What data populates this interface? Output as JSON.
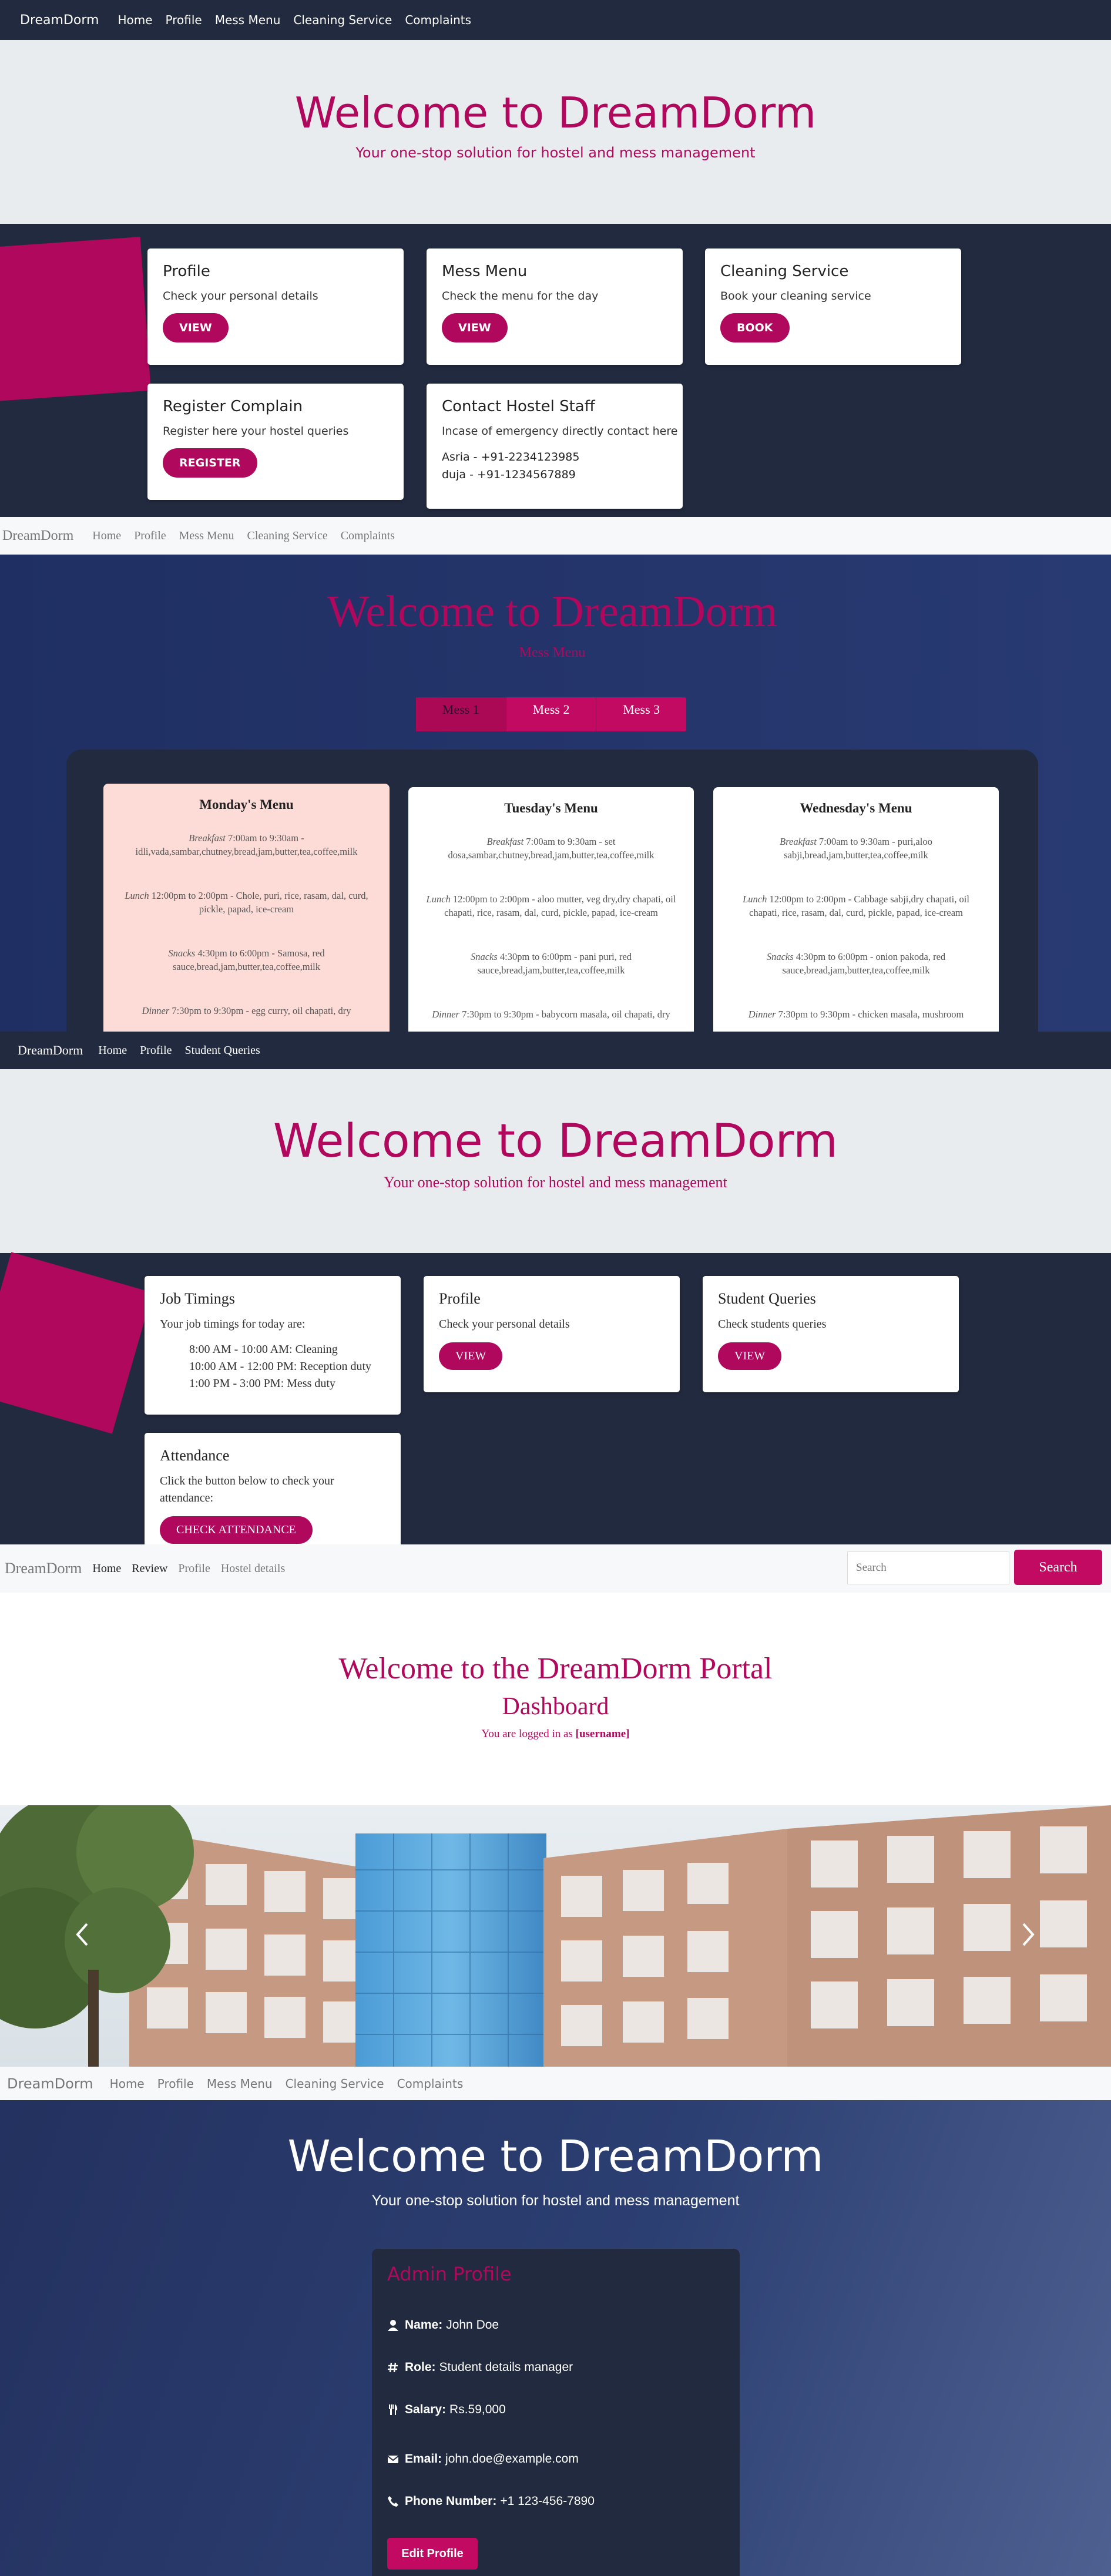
{
  "colors": {
    "accent": "#b0085c",
    "dark_navy": "#222a3f",
    "light_gray": "#e9ecef"
  },
  "s1": {
    "brand": "DreamDorm",
    "nav": [
      "Home",
      "Profile",
      "Mess Menu",
      "Cleaning Service",
      "Complaints"
    ],
    "title": "Welcome to DreamDorm",
    "subtitle": "Your one-stop solution for hostel and mess management",
    "cards": [
      {
        "title": "Profile",
        "text": "Check your personal details",
        "button": "VIEW"
      },
      {
        "title": "Mess Menu",
        "text": "Check the menu for the day",
        "button": "VIEW"
      },
      {
        "title": "Cleaning Service",
        "text": "Book your cleaning service",
        "button": "BOOK"
      },
      {
        "title": "Register Complain",
        "text": "Register here your hostel queries",
        "button": "REGISTER"
      }
    ],
    "contact": {
      "title": "Contact Hostel Staff",
      "text": "Incase of emergency directly contact here",
      "line1": "Asria - +91-2234123985",
      "line2": "duja - +91-1234567889"
    }
  },
  "s2": {
    "brand": "DreamDorm",
    "nav": [
      "Home",
      "Profile",
      "Mess Menu",
      "Cleaning Service",
      "Complaints"
    ],
    "title": "Welcome to DreamDorm",
    "subtitle": "Mess Menu",
    "tabs": [
      "Mess 1",
      "Mess 2",
      "Mess 3"
    ],
    "menus": [
      {
        "day": "Monday's Menu",
        "breakfast_label": "Breakfast",
        "breakfast": " 7:00am to 9:30am - idli,vada,sambar,chutney,bread,jam,butter,tea,coffee,milk",
        "lunch_label": "Lunch",
        "lunch": " 12:00pm to 2:00pm - Chole, puri, rice, rasam, dal, curd, pickle, papad, ice-cream",
        "snacks_label": "Snacks",
        "snacks": " 4:30pm to 6:00pm - Samosa, red sauce,bread,jam,butter,tea,coffee,milk",
        "dinner_label": "Dinner",
        "dinner": " 7:30pm to 9:30pm - egg curry, oil chapati, dry"
      },
      {
        "day": "Tuesday's Menu",
        "breakfast_label": "Breakfast",
        "breakfast": " 7:00am to 9:30am - set dosa,sambar,chutney,bread,jam,butter,tea,coffee,milk",
        "lunch_label": "Lunch",
        "lunch": " 12:00pm to 2:00pm - aloo mutter, veg dry,dry chapati, oil chapati, rice, rasam, dal, curd, pickle, papad, ice-cream",
        "snacks_label": "Snacks",
        "snacks": " 4:30pm to 6:00pm - pani puri, red sauce,bread,jam,butter,tea,coffee,milk",
        "dinner_label": "Dinner",
        "dinner": " 7:30pm to 9:30pm - babycorn masala, oil chapati, dry"
      },
      {
        "day": "Wednesday's Menu",
        "breakfast_label": "Breakfast",
        "breakfast": " 7:00am to 9:30am - puri,aloo sabji,bread,jam,butter,tea,coffee,milk",
        "lunch_label": "Lunch",
        "lunch": " 12:00pm to 2:00pm - Cabbage sabji,dry chapati, oil chapati, rice, rasam, dal, curd, pickle, papad, ice-cream",
        "snacks_label": "Snacks",
        "snacks": " 4:30pm to 6:00pm - onion pakoda, red sauce,bread,jam,butter,tea,coffee,milk",
        "dinner_label": "Dinner",
        "dinner": " 7:30pm to 9:30pm - chicken masala, mushroom"
      }
    ]
  },
  "s3": {
    "brand": "DreamDorm",
    "nav": [
      "Home",
      "Profile",
      "Student Queries"
    ],
    "title": "Welcome to DreamDorm",
    "subtitle": "Your one-stop solution for hostel and mess management",
    "job": {
      "title": "Job Timings",
      "text": "Your job timings for today are:",
      "t1": "8:00 AM - 10:00 AM: Cleaning",
      "t2": "10:00 AM - 12:00 PM: Reception duty",
      "t3": "1:00 PM - 3:00 PM: Mess duty"
    },
    "profile": {
      "title": "Profile",
      "text": "Check your personal details",
      "button": "VIEW"
    },
    "queries": {
      "title": "Student Queries",
      "text": "Check students queries",
      "button": "VIEW"
    },
    "attendance": {
      "title": "Attendance",
      "text": "Click the button below to check your attendance:",
      "button": "CHECK ATTENDANCE"
    }
  },
  "s4": {
    "brand": "DreamDorm",
    "nav": [
      "Home",
      "Review",
      "Profile",
      "Hostel details"
    ],
    "search_placeholder": "Search",
    "search_button": "Search",
    "title": "Welcome to the DreamDorm Portal",
    "dashboard": "Dashboard",
    "logged_prefix": "You are logged in as ",
    "username": "[username]"
  },
  "s5": {
    "brand": "DreamDorm",
    "nav": [
      "Home",
      "Profile",
      "Mess Menu",
      "Cleaning Service",
      "Complaints"
    ],
    "title": "Welcome to DreamDorm",
    "subtitle": "Your one-stop solution for hostel and mess management",
    "panel_title": "Admin Profile",
    "name_label": "Name:",
    "name": "John Doe",
    "role_label": "Role:",
    "role": "Student details manager",
    "salary_label": "Salary:",
    "salary": "Rs.59,000",
    "email_label": "Email:",
    "email": "john.doe@example.com",
    "phone_label": "Phone Number:",
    "phone": "+1 123-456-7890",
    "edit_button": "Edit Profile"
  }
}
